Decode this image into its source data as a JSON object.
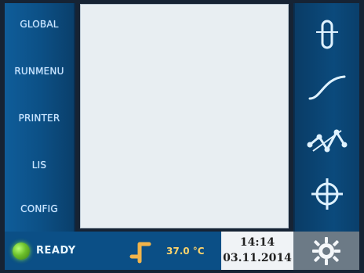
{
  "left_menu": {
    "items": [
      {
        "label": "GLOBAL"
      },
      {
        "label": "RUNMENU"
      },
      {
        "label": "PRINTER"
      },
      {
        "label": "LIS"
      },
      {
        "label": "CONFIG"
      }
    ]
  },
  "right_panel": {
    "buttons": [
      {
        "icon": "tube-icon"
      },
      {
        "icon": "curve-icon"
      },
      {
        "icon": "graph-icon"
      },
      {
        "icon": "crosshair-icon"
      }
    ]
  },
  "status_bar": {
    "status_text": "READY",
    "status_icon": "status-led",
    "temperature": "37.0 °C",
    "time": "14:14",
    "date": "03.11.2014",
    "settings_icon": "gear-icon"
  },
  "colors": {
    "menu_blue": "#0f5d9a",
    "status_green": "#6cc02b",
    "temp_yellow": "#ffd46b"
  }
}
